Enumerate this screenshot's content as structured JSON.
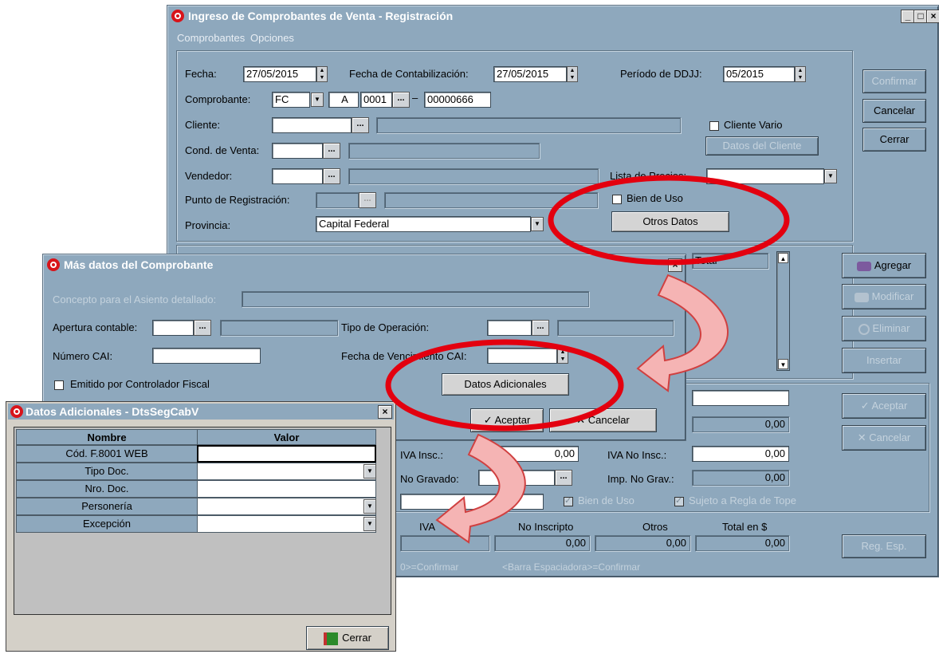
{
  "main_window": {
    "title": "Ingreso de Comprobantes de Venta - Registración",
    "menu": [
      "Comprobantes",
      "Opciones"
    ],
    "form": {
      "fecha_label": "Fecha:",
      "fecha_value": "27/05/2015",
      "fecha_contab_label": "Fecha de Contabilización:",
      "fecha_contab_value": "27/05/2015",
      "periodo_label": "Período de DDJJ:",
      "periodo_value": "05/2015",
      "comprobante_label": "Comprobante:",
      "comprobante_tipo": "FC",
      "comprobante_letra": "A",
      "comprobante_punto": "0001",
      "comprobante_numero": "00000666",
      "cliente_label": "Cliente:",
      "cliente_vario_label": "Cliente Vario",
      "datos_cliente_button": "Datos del Cliente",
      "cond_venta_label": "Cond. de Venta:",
      "vendedor_label": "Vendedor:",
      "lista_precios_label": "Lista de Precios:",
      "punto_registracion_label": "Punto de Registración:",
      "bien_de_uso_label": "Bien de Uso",
      "provincia_label": "Provincia:",
      "provincia_value": "Capital Federal",
      "otros_datos_button": "Otros Datos"
    },
    "side_buttons": {
      "confirmar": "Confirmar",
      "cancelar": "Cancelar",
      "cerrar": "Cerrar"
    },
    "items": {
      "total_header": "Total",
      "agregar": "Agregar",
      "modificar": "Modificar",
      "eliminar": "Eliminar",
      "insertar": "Insertar"
    },
    "detail": {
      "aceptar": "Aceptar",
      "cancelar": "Cancelar",
      "value_1": "0,00",
      "iva_insc_label": "IVA Insc.:",
      "iva_insc_value": "0,00",
      "iva_no_insc_label": "IVA No Insc.:",
      "iva_no_insc_value": "0,00",
      "no_gravado_label": "No Gravado:",
      "imp_no_grav_label": "Imp. No Grav.:",
      "imp_no_grav_value": "0,00",
      "bien_de_uso_label": "Bien de Uso",
      "sujeto_tope_label": "Sujeto a Regla de Tope"
    },
    "totals": {
      "iva_label": "IVA",
      "no_inscripto_label": "No Inscripto",
      "otros_label": "Otros",
      "total_label": "Total en $",
      "no_inscripto_value": "0,00",
      "otros_value": "0,00",
      "total_value": "0,00",
      "reg_esp_button": "Reg. Esp."
    },
    "status_bar": {
      "left": "0>=Confirmar",
      "right": "<Barra Espaciadora>=Confirmar"
    }
  },
  "mas_datos_window": {
    "title": "Más datos del Comprobante",
    "concepto_label": "Concepto para el Asiento detallado:",
    "apertura_label": "Apertura contable:",
    "tipo_operacion_label": "Tipo de Operación:",
    "numero_cai_label": "Número CAI:",
    "fecha_venc_cai_label": "Fecha de Vencimiento CAI:",
    "emitido_label": "Emitido por Controlador Fiscal",
    "datos_adicionales_button": "Datos Adicionales",
    "aceptar_button": "Aceptar",
    "cancelar_button": "Cancelar"
  },
  "datos_adicionales_window": {
    "title": "Datos Adicionales - DtsSegCabV",
    "col_nombre": "Nombre",
    "col_valor": "Valor",
    "rows": [
      "Cód. F.8001 WEB",
      "Tipo Doc.",
      "Nro. Doc.",
      "Personería",
      "Excepción"
    ],
    "cerrar_button": "Cerrar"
  },
  "colors": {
    "window_bg": "#8ea8bd",
    "annotation_red": "#e3000f",
    "arrow_fill": "#f5b4b4",
    "arrow_stroke": "#d04040"
  }
}
